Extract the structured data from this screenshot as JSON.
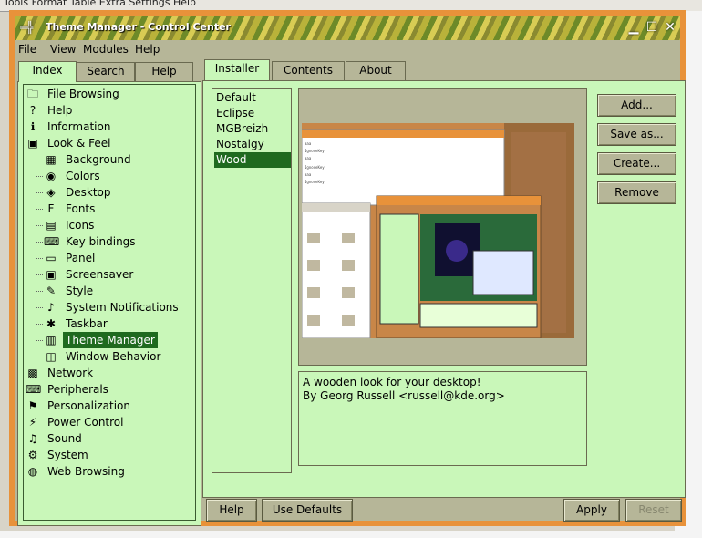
{
  "background": {
    "top_text": "Tools  Format  Table  Extra  Settings  Help"
  },
  "window": {
    "title": "Theme Manager - Control Center"
  },
  "menubar": [
    "File",
    "View",
    "Modules",
    "Help"
  ],
  "left_tabs": [
    "Index",
    "Search",
    "Help"
  ],
  "tree": [
    {
      "label": "File Browsing",
      "icon": "folder-icon",
      "glyph": "🗀",
      "indent": 0
    },
    {
      "label": "Help",
      "icon": "help-icon",
      "glyph": "?",
      "indent": 0
    },
    {
      "label": "Information",
      "icon": "info-icon",
      "glyph": "ℹ",
      "indent": 0
    },
    {
      "label": "Look & Feel",
      "icon": "look-feel-icon",
      "glyph": "▣",
      "indent": 0
    },
    {
      "label": "Background",
      "icon": "background-icon",
      "glyph": "▦",
      "indent": 1
    },
    {
      "label": "Colors",
      "icon": "colors-icon",
      "glyph": "◉",
      "indent": 1
    },
    {
      "label": "Desktop",
      "icon": "desktop-icon",
      "glyph": "◈",
      "indent": 1
    },
    {
      "label": "Fonts",
      "icon": "fonts-icon",
      "glyph": "F",
      "indent": 1
    },
    {
      "label": "Icons",
      "icon": "icons-icon",
      "glyph": "▤",
      "indent": 1
    },
    {
      "label": "Key bindings",
      "icon": "key-bindings-icon",
      "glyph": "⌨",
      "indent": 1
    },
    {
      "label": "Panel",
      "icon": "panel-icon",
      "glyph": "▭",
      "indent": 1
    },
    {
      "label": "Screensaver",
      "icon": "screensaver-icon",
      "glyph": "▣",
      "indent": 1
    },
    {
      "label": "Style",
      "icon": "style-icon",
      "glyph": "✎",
      "indent": 1
    },
    {
      "label": "System Notifications",
      "icon": "notifications-icon",
      "glyph": "♪",
      "indent": 1
    },
    {
      "label": "Taskbar",
      "icon": "taskbar-icon",
      "glyph": "✱",
      "indent": 1
    },
    {
      "label": "Theme Manager",
      "icon": "theme-manager-icon",
      "glyph": "▥",
      "indent": 1,
      "selected": true
    },
    {
      "label": "Window Behavior",
      "icon": "window-behavior-icon",
      "glyph": "◫",
      "indent": 1
    },
    {
      "label": "Network",
      "icon": "network-icon",
      "glyph": "▩",
      "indent": 0
    },
    {
      "label": "Peripherals",
      "icon": "peripherals-icon",
      "glyph": "⌨",
      "indent": 0
    },
    {
      "label": "Personalization",
      "icon": "personalization-icon",
      "glyph": "⚑",
      "indent": 0
    },
    {
      "label": "Power Control",
      "icon": "power-icon",
      "glyph": "⚡",
      "indent": 0
    },
    {
      "label": "Sound",
      "icon": "sound-icon",
      "glyph": "♫",
      "indent": 0
    },
    {
      "label": "System",
      "icon": "system-icon",
      "glyph": "⚙",
      "indent": 0
    },
    {
      "label": "Web Browsing",
      "icon": "globe-icon",
      "glyph": "◍",
      "indent": 0
    }
  ],
  "right_tabs": [
    "Installer",
    "Contents",
    "About"
  ],
  "themes": [
    "Default",
    "Eclipse",
    "MGBreizh",
    "Nostalgy",
    "Wood"
  ],
  "selected_theme": "Wood",
  "actions": {
    "add": "Add...",
    "save_as": "Save as...",
    "create": "Create...",
    "remove": "Remove"
  },
  "description": {
    "line1": "A wooden look for your desktop!",
    "line2": "By Georg Russell <russell@kde.org>"
  },
  "bottom": {
    "help": "Help",
    "use_defaults": "Use Defaults",
    "apply": "Apply",
    "reset": "Reset"
  },
  "colors": {
    "frame": "#e8923a",
    "panel": "#c9f7b9",
    "chrome": "#b6b698",
    "selection": "#1f6a1f"
  }
}
